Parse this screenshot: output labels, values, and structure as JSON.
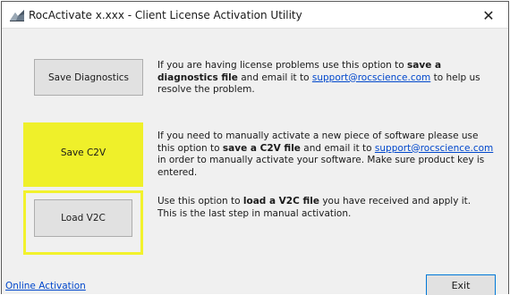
{
  "window": {
    "title": "RocActivate x.xxx - Client License Activation Utility",
    "close_glyph": "✕",
    "icon": "rocscience-app-icon"
  },
  "options": [
    {
      "button_label": "Save Diagnostics",
      "text_1": "If you are having license problems use this option to ",
      "bold": "save a diagnostics file",
      "text_2": " and email it to ",
      "link": "support@rocscience.com",
      "text_3": " to help us resolve the problem.",
      "highlighted": false
    },
    {
      "button_label": "Save C2V",
      "text_1": "If you need to manually activate a new piece of software please use this option to ",
      "bold": "save a C2V file",
      "text_2": " and email it to ",
      "link": "support@rocscience.com",
      "text_3": " in order to manually activate your software. Make sure product key is entered.",
      "highlighted": true
    },
    {
      "button_label": "Load V2C",
      "text_1": "Use this option to ",
      "bold": "load a V2C file",
      "text_2": " you have received and apply it. This is the last step in manual activation.",
      "highlighted": true
    }
  ],
  "footer": {
    "online_activation_label": "Online Activation",
    "exit_label": "Exit"
  },
  "colors": {
    "highlight": "#eff02a",
    "link": "#0047cc",
    "focus_border": "#0078d7"
  }
}
